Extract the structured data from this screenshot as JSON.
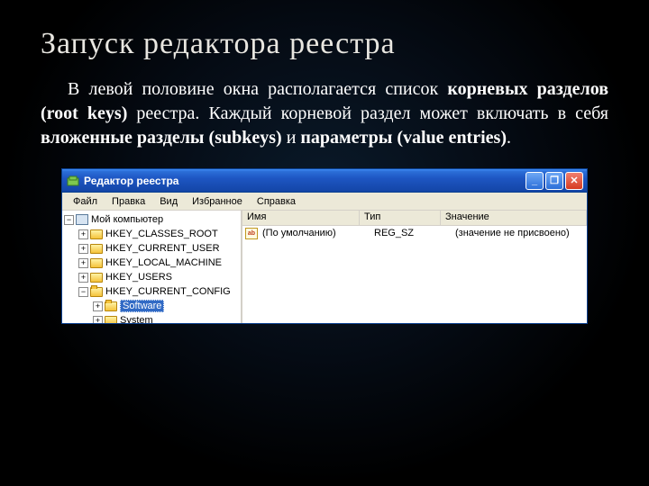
{
  "slide": {
    "title": "Запуск редактора реестра",
    "body_plain1": "В левой половине окна располагается список ",
    "body_bold1": "корневых разделов (root keys)",
    "body_plain2": " реестра. Каждый корневой раздел может включать в себя ",
    "body_bold2": "вложенные разделы (subkeys)",
    "body_plain3": " и ",
    "body_bold3": "параметры (value entries)",
    "body_plain4": "."
  },
  "window": {
    "title": "Редактор реестра",
    "btn_min": "_",
    "btn_max": "❐",
    "btn_close": "✕"
  },
  "menu": {
    "file": "Файл",
    "edit": "Правка",
    "view": "Вид",
    "fav": "Избранное",
    "help": "Справка"
  },
  "tree": {
    "root": "Мой компьютер",
    "k0": "HKEY_CLASSES_ROOT",
    "k1": "HKEY_CURRENT_USER",
    "k2": "HKEY_LOCAL_MACHINE",
    "k3": "HKEY_USERS",
    "k4": "HKEY_CURRENT_CONFIG",
    "k4a": "Software",
    "k4b": "System",
    "expand_minus": "−",
    "expand_plus": "+"
  },
  "list": {
    "col_name": "Имя",
    "col_type": "Тип",
    "col_val": "Значение",
    "default_name": "(По умолчанию)",
    "default_type": "REG_SZ",
    "default_val": "(значение не присвоено)",
    "icon_text": "ab"
  }
}
